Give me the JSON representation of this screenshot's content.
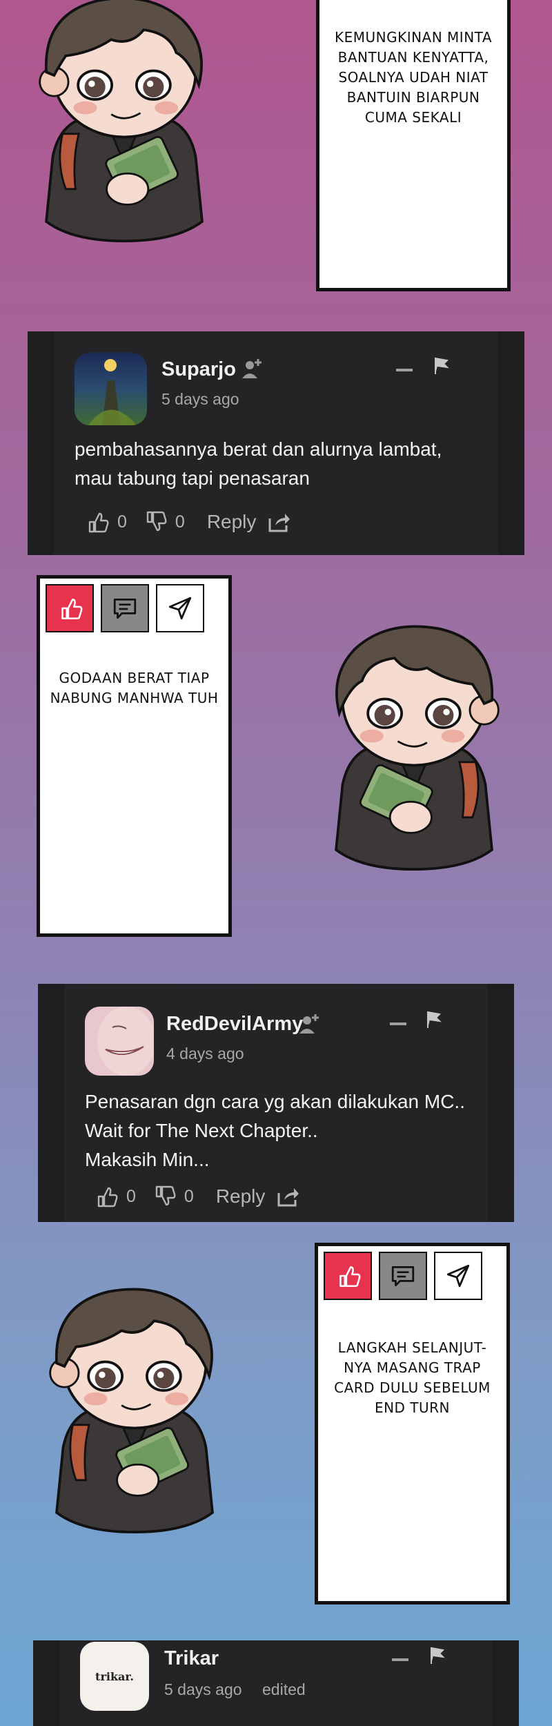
{
  "panels": [
    {
      "text": "KEMUNGKINAN MINTA\nBANTUAN KENYATTA,\nSOALNYA UDAH NIAT\nBANTUIN BIARPUN\nCUMA SEKALI"
    },
    {
      "text": "GODAAN BERAT TIAP\nNABUNG MANHWA TUH"
    },
    {
      "text": "LANGKAH SELANJUT-\nNYA MASANG TRAP\nCARD DULU SEBELUM\nEND TURN"
    }
  ],
  "comments": [
    {
      "username": "Suparjo",
      "time": "5 days ago",
      "text": "pembahasannya berat dan alurnya lambat,\nmau tabung tapi penasaran",
      "likes": "0",
      "dislikes": "0",
      "reply_label": "Reply"
    },
    {
      "username": "RedDevilArmy",
      "time": "4 days ago",
      "text": "Penasaran dgn cara yg akan dilakukan MC..\nWait for The Next Chapter..\nMakasih Min...",
      "likes": "0",
      "dislikes": "0",
      "reply_label": "Reply"
    },
    {
      "username": "Trikar",
      "time": "5 days ago",
      "edited": "edited",
      "avatar_text": "trikar."
    }
  ],
  "icons": [
    "thumbs-up-icon",
    "chat-bubble-icon",
    "paper-plane-icon",
    "add-user-icon",
    "minimize-icon",
    "flag-icon",
    "thumbs-down-icon",
    "share-icon"
  ],
  "colors": {
    "like": "#e8334f",
    "chat": "#888888",
    "comment_bg": "#242426",
    "text": "#f2f2f2"
  }
}
